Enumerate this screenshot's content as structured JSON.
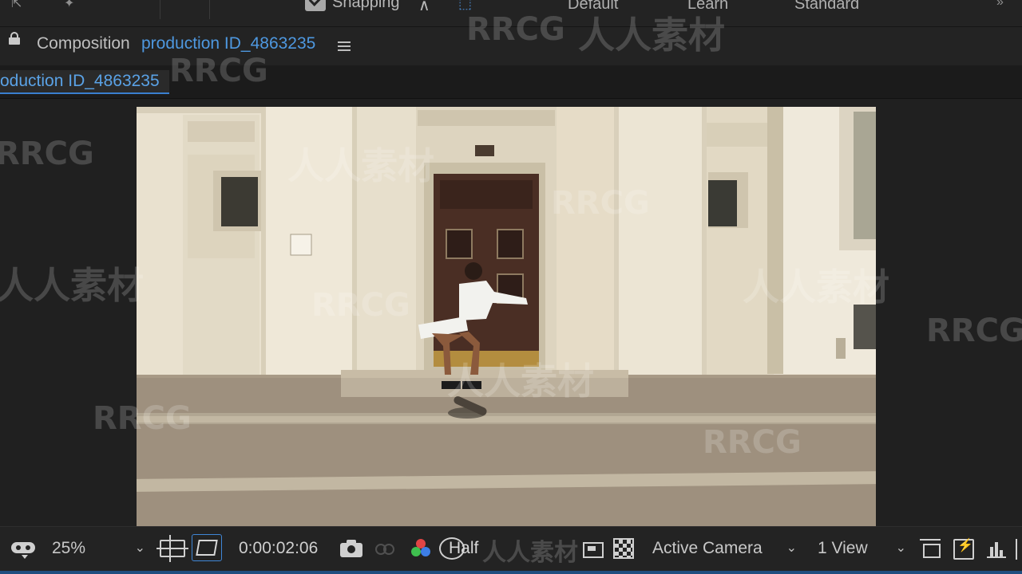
{
  "toolbar": {
    "snapping_label": "Snapping",
    "snapping_checked": true,
    "workspaces": [
      "Default",
      "Learn",
      "Standard"
    ]
  },
  "composition": {
    "panel_label": "Composition",
    "name": "production ID_4863235",
    "tab_label": "oduction ID_4863235"
  },
  "viewer_controls": {
    "zoom": "25%",
    "timecode": "0:00:02:06",
    "resolution": "Half",
    "camera": "Active Camera",
    "views": "1 View"
  },
  "watermarks": [
    "RRCG",
    "人人素材"
  ],
  "colors": {
    "accent_blue": "#4e98e0",
    "panel_bg": "#232323",
    "viewer_bg": "#202020"
  },
  "icons": {
    "snapping_extras": [
      "snap-edges-icon",
      "snap-features-icon"
    ],
    "viewer": [
      "mask-visibility-icon",
      "region-of-interest-icon",
      "transparency-grid-toggle-icon",
      "camera-snapshot-icon",
      "show-snapshot-icon",
      "rgb-channel-icon",
      "fast-previews-icon",
      "checkerboard-icon",
      "view-layout-icon",
      "flowchart-icon",
      "graph-icon"
    ]
  }
}
